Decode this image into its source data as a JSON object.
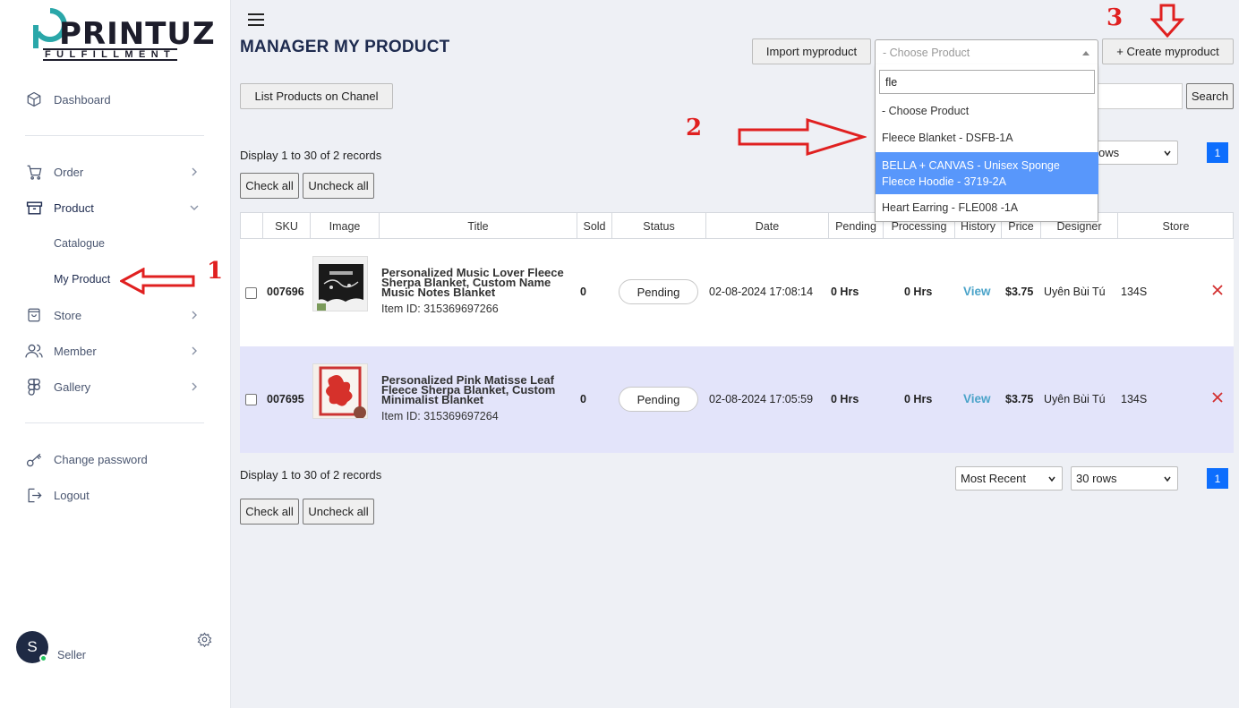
{
  "brand": {
    "name": "PRINTUZ",
    "sub": "FULFILLMENT"
  },
  "sidebar": {
    "dashboard": "Dashboard",
    "order": "Order",
    "product": "Product",
    "catalogue": "Catalogue",
    "my_product": "My Product",
    "store": "Store",
    "member": "Member",
    "gallery": "Gallery",
    "change_password": "Change password",
    "logout": "Logout",
    "avatar_letter": "S",
    "role": "Seller"
  },
  "header": {
    "title": "MANAGER MY PRODUCT",
    "import_btn": "Import myproduct",
    "create_btn": "+ Create myproduct",
    "list_channel_btn": "List Products on Chanel",
    "search_btn": "Search"
  },
  "dropdown": {
    "placeholder": "- Choose Product",
    "search_value": "fle",
    "options": [
      "- Choose Product",
      "Fleece Blanket - DSFB-1A",
      "BELLA + CANVAS - Unisex Sponge Fleece Hoodie - 3719-2A",
      "Heart Earring - FLE008 -1A"
    ]
  },
  "listing": {
    "records_text": "Display 1 to 30 of 2 records",
    "check_all": "Check all",
    "uncheck_all": "Uncheck all",
    "rows_partial": "ows",
    "sort": "Most Recent",
    "rows": "30 rows",
    "page": "1"
  },
  "table": {
    "headers": [
      "SKU",
      "Image",
      "Title",
      "Sold",
      "Status",
      "Date",
      "Pending",
      "Processing",
      "History",
      "Price",
      "Designer",
      "Store"
    ],
    "rows": [
      {
        "sku": "007696",
        "title": "Personalized Music Lover Fleece Sherpa Blanket, Custom Name Music Notes Blanket",
        "item_id": "Item ID: 315369697266",
        "sold": "0",
        "status": "Pending",
        "date": "02-08-2024 17:08:14",
        "pending": "0 Hrs",
        "processing": "0 Hrs",
        "history": "View",
        "price": "$3.75",
        "designer": "Uyên Bùi Tú",
        "store": "134S"
      },
      {
        "sku": "007695",
        "title": "Personalized Pink Matisse Leaf Fleece Sherpa Blanket, Custom Minimalist Blanket",
        "item_id": "Item ID: 315369697264",
        "sold": "0",
        "status": "Pending",
        "date": "02-08-2024 17:05:59",
        "pending": "0 Hrs",
        "processing": "0 Hrs",
        "history": "View",
        "price": "$3.75",
        "designer": "Uyên Bùi Tú",
        "store": "134S"
      }
    ]
  },
  "annotations": {
    "one": "1",
    "two": "2",
    "three": "3"
  },
  "colors": {
    "accent": "#0d6efd",
    "annotation": "#e02020",
    "row_highlight": "#e3e4fa",
    "dropdown_highlight": "#5897fb"
  }
}
